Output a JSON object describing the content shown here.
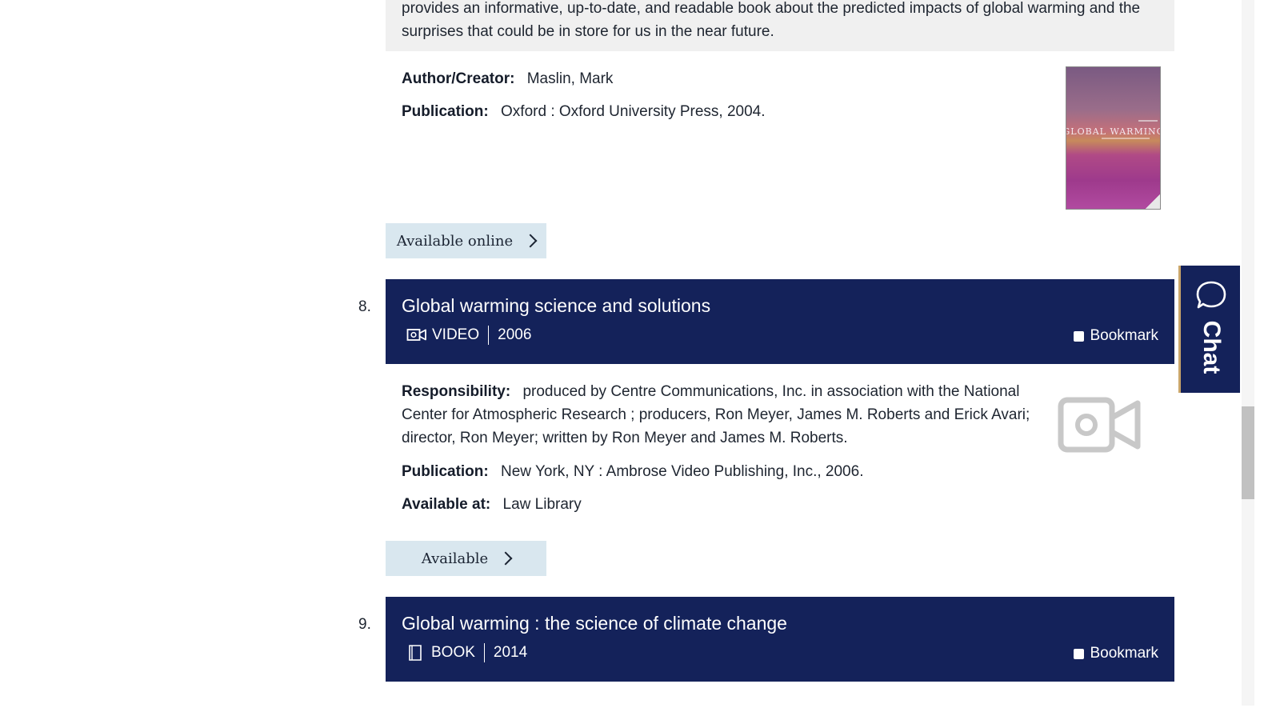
{
  "record7": {
    "summary": "provides an informative, up-to-date, and readable book about the predicted impacts of global warming and the surprises that could be in store for us in the near future.",
    "author_label": "Author/Creator:",
    "author_value": "Maslin, Mark",
    "publication_label": "Publication:",
    "publication_value": "Oxford : Oxford University Press, 2004.",
    "cover_title": "GLOBAL WARMING",
    "button_label": "Available online"
  },
  "record8": {
    "number": "8.",
    "title": "Global warming science and solutions",
    "format_icon": "video-camera-icon",
    "format": "VIDEO",
    "year": "2006",
    "bookmark_label": "Bookmark",
    "responsibility_label": "Responsibility:",
    "responsibility_value": "produced by Centre Communications, Inc. in association with the National Center for Atmospheric Research ; producers, Ron Meyer, James M. Roberts and Erick Avari; director, Ron Meyer; written by Ron Meyer and James M. Roberts.",
    "publication_label": "Publication:",
    "publication_value": "New York, NY : Ambrose Video Publishing, Inc., 2006.",
    "available_at_label": "Available at:",
    "available_at_value": "Law Library",
    "button_label": "Available"
  },
  "record9": {
    "number": "9.",
    "title": "Global warming : the science of climate change",
    "format_icon": "book-icon",
    "format": "BOOK",
    "year": "2014",
    "bookmark_label": "Bookmark"
  },
  "chat": {
    "label": "Chat",
    "icon": "chat-bubble-icon"
  },
  "colors": {
    "header_bg": "#14225a",
    "button_bg": "#d9e7ef",
    "summary_bg": "#f0f0f0",
    "chat_border": "#c9a56a"
  }
}
